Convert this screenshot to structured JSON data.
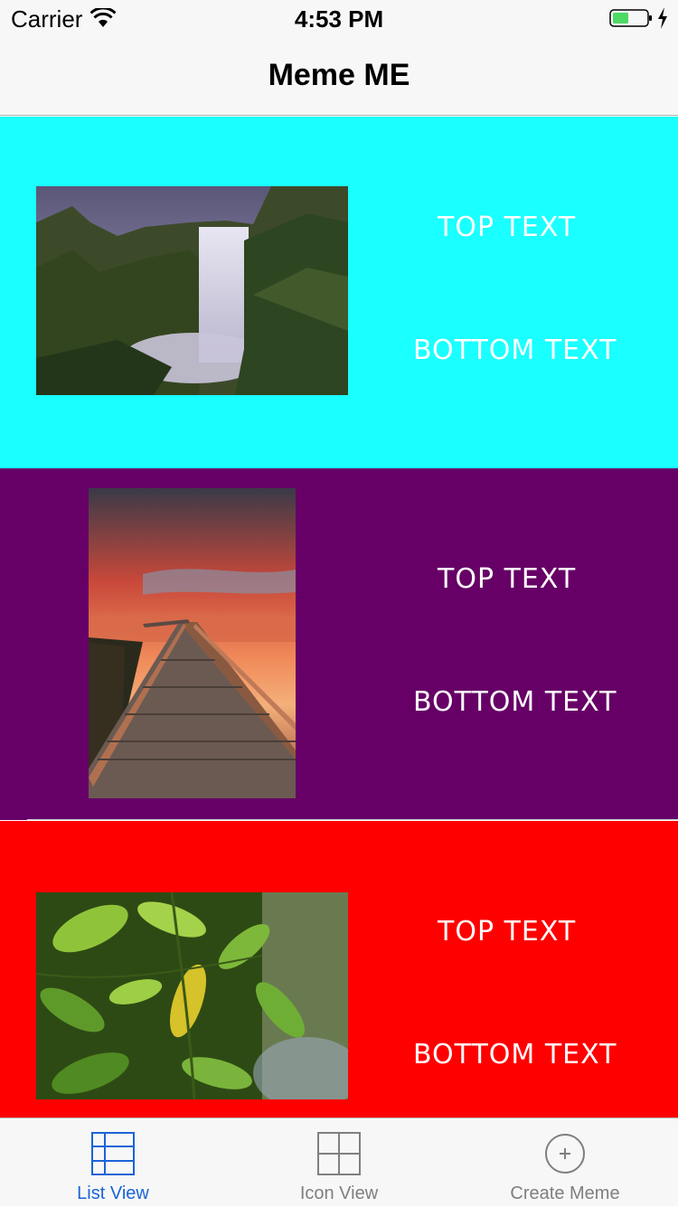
{
  "status_bar": {
    "carrier": "Carrier",
    "time": "4:53 PM",
    "icons": [
      "wifi-icon",
      "battery-icon",
      "charging-bolt-icon"
    ],
    "battery_color": "#4cd964"
  },
  "nav": {
    "title": "Meme ME"
  },
  "memes": [
    {
      "top_text": "TOP TEXT",
      "bottom_text": "BOTTOM TEXT",
      "background": "#1affff",
      "image": "waterfall photo"
    },
    {
      "top_text": "TOP TEXT",
      "bottom_text": "BOTTOM TEXT",
      "background": "#660066",
      "image": "boardwalk sunset photo"
    },
    {
      "top_text": "TOP TEXT",
      "bottom_text": "BOTTOM TEXT",
      "background": "#ff0000",
      "image": "green leaves photo"
    }
  ],
  "tabs": [
    {
      "label": "List View",
      "icon": "list-view-icon",
      "selected": true
    },
    {
      "label": "Icon View",
      "icon": "grid-view-icon",
      "selected": false
    },
    {
      "label": "Create Meme",
      "icon": "plus-circle-icon",
      "selected": false
    }
  ],
  "colors": {
    "tab_active": "#1a64d6",
    "tab_inactive": "#7f7f7f"
  }
}
